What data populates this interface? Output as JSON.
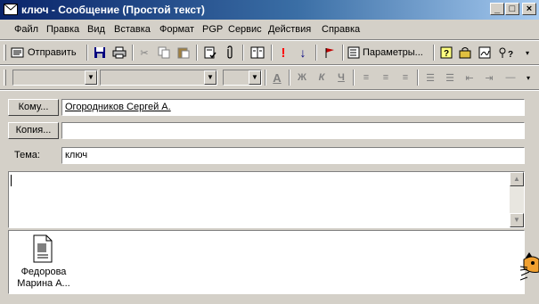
{
  "window": {
    "title": "ключ - Сообщение (Простой текст)",
    "controls": {
      "minimize": "_",
      "maximize": "□",
      "close": "×"
    }
  },
  "menu": {
    "items": [
      {
        "label": "Файл"
      },
      {
        "label": "Правка"
      },
      {
        "label": "Вид"
      },
      {
        "label": "Вставка"
      },
      {
        "label": "Формат"
      },
      {
        "label": "PGP"
      },
      {
        "label": "Сервис"
      },
      {
        "label": "Действия"
      },
      {
        "label": "Справка"
      }
    ]
  },
  "toolbar": {
    "send_label": "Отправить",
    "params_label": "Параметры..."
  },
  "format_toolbar": {
    "font_color_glyph": "A",
    "bold": "Ж",
    "italic": "К",
    "underline": "Ч"
  },
  "fields": {
    "to_button": "Кому...",
    "to_value": "Огородников Сергей А.",
    "cc_button": "Копия...",
    "cc_value": "",
    "subject_label": "Тема:",
    "subject_value": "ключ"
  },
  "attachment": {
    "name": "Федорова Марина А...",
    "icon": "document-icon"
  },
  "colors": {
    "titlebar_start": "#0a246a",
    "titlebar_end": "#a6caf0",
    "chrome": "#d4d0c8",
    "importance_high": "#ff0000",
    "importance_low": "#000080"
  }
}
